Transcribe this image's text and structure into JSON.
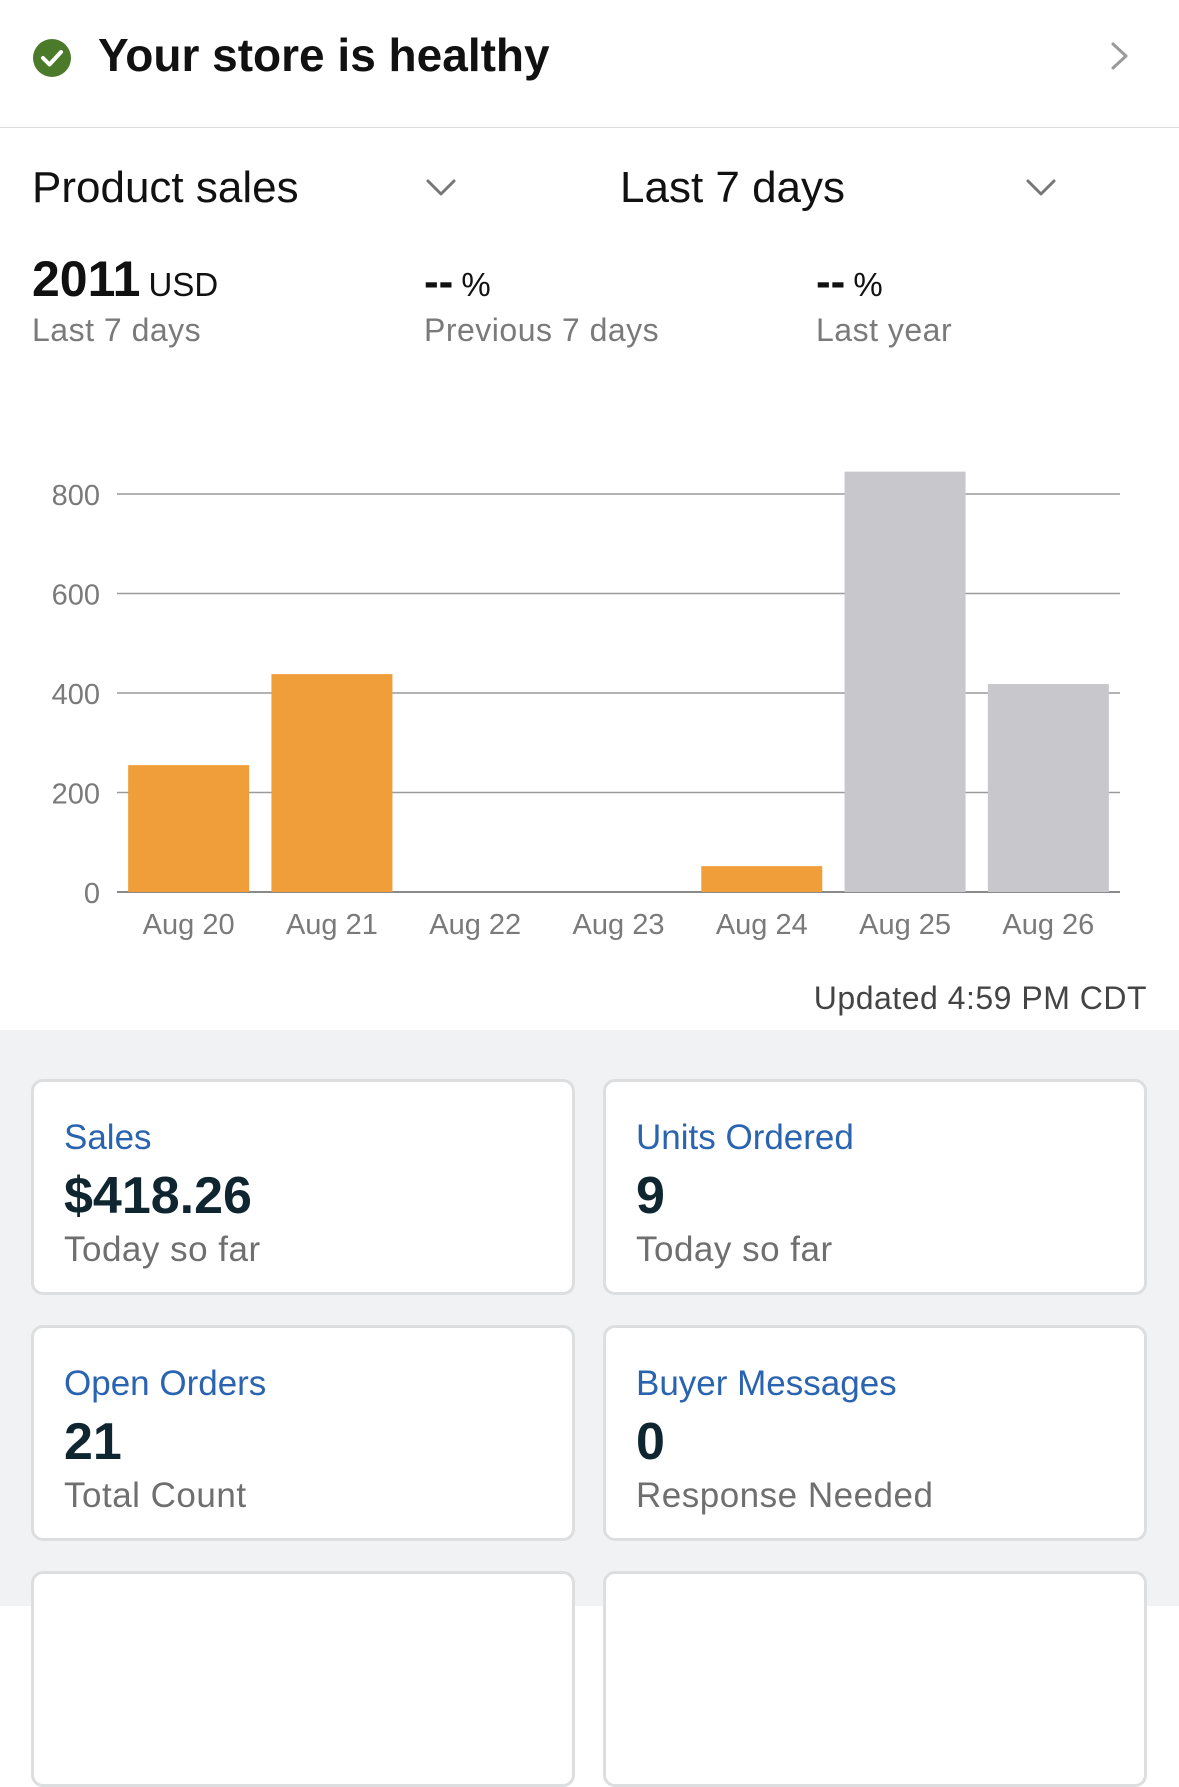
{
  "health": {
    "title": "Your store is healthy",
    "icon": "check-circle-icon",
    "status_color": "#4a7a2a"
  },
  "controls": {
    "metric": "Product sales",
    "period": "Last 7 days"
  },
  "stats": [
    {
      "value": "2011",
      "unit": "USD",
      "label": "Last 7 days"
    },
    {
      "value": "--",
      "unit": "%",
      "label": "Previous 7 days"
    },
    {
      "value": "--",
      "unit": "%",
      "label": "Last year"
    }
  ],
  "chart_data": {
    "type": "bar",
    "categories": [
      "Aug 20",
      "Aug 21",
      "Aug 22",
      "Aug 23",
      "Aug 24",
      "Aug 25",
      "Aug 26"
    ],
    "values": [
      255,
      438,
      0,
      0,
      52,
      845,
      418
    ],
    "bar_colors": [
      "#f09e3a",
      "#f09e3a",
      "#f09e3a",
      "#f09e3a",
      "#f09e3a",
      "#c8c8cc",
      "#c8c8cc"
    ],
    "yticks": [
      0,
      200,
      400,
      600,
      800
    ],
    "ylim": [
      0,
      845
    ],
    "grid": true,
    "title": "",
    "xlabel": "",
    "ylabel": ""
  },
  "updated": "Updated 4:59 PM CDT",
  "cards": [
    {
      "title": "Sales",
      "value": "$418.26",
      "sub": "Today so far"
    },
    {
      "title": "Units Ordered",
      "value": "9",
      "sub": "Today so far"
    },
    {
      "title": "Open Orders",
      "value": "21",
      "sub": "Total Count"
    },
    {
      "title": "Buyer Messages",
      "value": "0",
      "sub": "Response Needed"
    },
    {
      "title": "",
      "value": "",
      "sub": ""
    },
    {
      "title": "",
      "value": "",
      "sub": ""
    }
  ]
}
